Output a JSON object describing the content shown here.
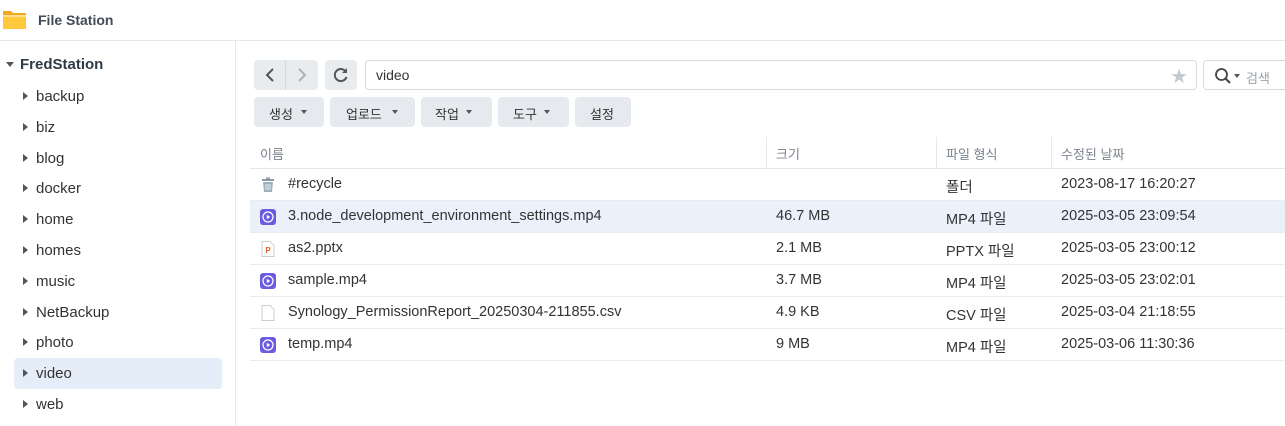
{
  "app": {
    "title": "File Station",
    "icon": "folder-icon"
  },
  "sidebar": {
    "root": "FredStation",
    "items": [
      {
        "label": "backup"
      },
      {
        "label": "biz"
      },
      {
        "label": "blog"
      },
      {
        "label": "docker"
      },
      {
        "label": "home"
      },
      {
        "label": "homes"
      },
      {
        "label": "music"
      },
      {
        "label": "NetBackup"
      },
      {
        "label": "photo"
      },
      {
        "label": "video",
        "selected": true
      },
      {
        "label": "web"
      }
    ]
  },
  "toolbar": {
    "path": "video",
    "search_placeholder": "검색",
    "buttons": [
      {
        "label": "생성",
        "dropdown": true
      },
      {
        "label": "업로드",
        "dropdown": true
      },
      {
        "label": "작업",
        "dropdown": true
      },
      {
        "label": "도구",
        "dropdown": true
      },
      {
        "label": "설정",
        "dropdown": false
      }
    ]
  },
  "grid": {
    "columns": [
      "이름",
      "크기",
      "파일 형식",
      "수정된 날짜"
    ],
    "rows": [
      {
        "name": "#recycle",
        "size": "",
        "type": "폴더",
        "date": "2023-08-17 16:20:27",
        "icon": "recycle-bin-icon"
      },
      {
        "name": "3.node_development_environment_settings.mp4",
        "size": "46.7 MB",
        "type": "MP4 파일",
        "date": "2025-03-05 23:09:54",
        "icon": "video-file-icon",
        "selected": true
      },
      {
        "name": "as2.pptx",
        "size": "2.1 MB",
        "type": "PPTX 파일",
        "date": "2025-03-05 23:00:12",
        "icon": "pptx-file-icon"
      },
      {
        "name": "sample.mp4",
        "size": "3.7 MB",
        "type": "MP4 파일",
        "date": "2025-03-05 23:02:01",
        "icon": "video-file-icon"
      },
      {
        "name": "Synology_PermissionReport_20250304-211855.csv",
        "size": "4.9 KB",
        "type": "CSV 파일",
        "date": "2025-03-04 21:18:55",
        "icon": "generic-file-icon"
      },
      {
        "name": "temp.mp4",
        "size": "9 MB",
        "type": "MP4 파일",
        "date": "2025-03-06 11:30:36",
        "icon": "video-file-icon"
      }
    ]
  },
  "colors": {
    "accent": "#6a5be0",
    "selected_row": "#eaf1fb",
    "folder": "#f5a623"
  }
}
